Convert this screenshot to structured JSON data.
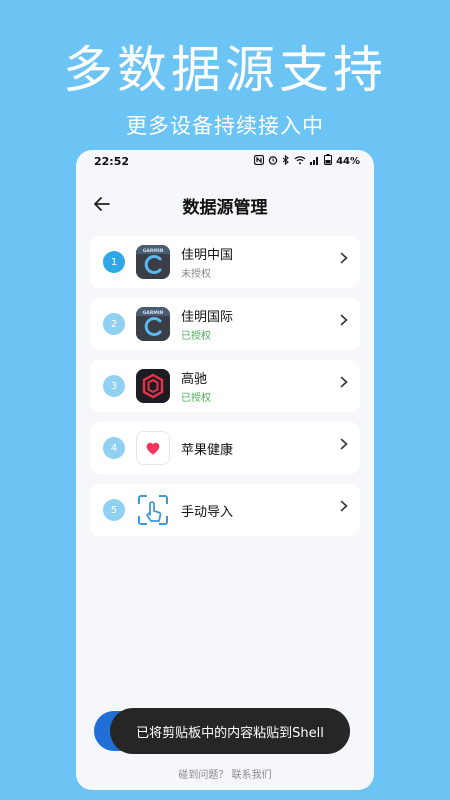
{
  "hero": {
    "title": "多数据源支持",
    "subtitle": "更多设备持续接入中"
  },
  "status_bar": {
    "time": "22:52",
    "battery": "44%",
    "icons": [
      "nfc-icon",
      "alarm-icon",
      "bluetooth-icon",
      "wifi-icon",
      "signal-icon",
      "battery-icon"
    ]
  },
  "nav": {
    "back_icon": "arrow-left-icon",
    "title": "数据源管理"
  },
  "sources": [
    {
      "index": "1",
      "name": "佳明中国",
      "status": "未授权",
      "status_color": "#888888",
      "icon": "garmin-icon",
      "highlight": true
    },
    {
      "index": "2",
      "name": "佳明国际",
      "status": "已授权",
      "status_color": "#4cae5a",
      "icon": "garmin-icon",
      "highlight": false
    },
    {
      "index": "3",
      "name": "高驰",
      "status": "已授权",
      "status_color": "#4cae5a",
      "icon": "coros-icon",
      "highlight": false
    },
    {
      "index": "4",
      "name": "苹果健康",
      "status": "",
      "icon": "apple-health-icon",
      "highlight": false
    },
    {
      "index": "5",
      "name": "手动导入",
      "status": "",
      "icon": "manual-import-icon",
      "highlight": false
    }
  ],
  "toast": {
    "text": "已将剪贴板中的内容粘贴到Shell"
  },
  "footer": {
    "contact": "碰到问题？ 联系我们"
  }
}
